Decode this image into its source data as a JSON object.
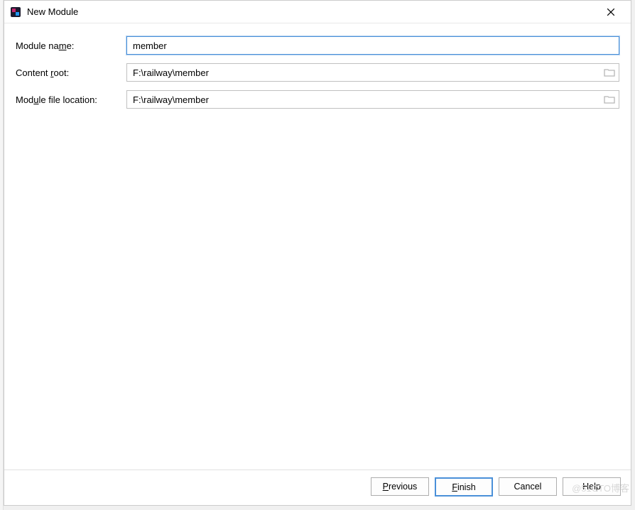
{
  "window": {
    "title": "New Module"
  },
  "form": {
    "module_name": {
      "label_pre": "Module na",
      "label_ul": "m",
      "label_post": "e:",
      "value": "member"
    },
    "content_root": {
      "label_pre": "Content ",
      "label_ul": "r",
      "label_post": "oot:",
      "value": "F:\\railway\\member"
    },
    "module_file_location": {
      "label_pre": "Mod",
      "label_ul": "u",
      "label_post": "le file location:",
      "value": "F:\\railway\\member"
    }
  },
  "buttons": {
    "previous_ul": "P",
    "previous_post": "revious",
    "finish_ul": "F",
    "finish_post": "inish",
    "cancel": "Cancel",
    "help": "Help"
  },
  "watermark": "@51CTO博客"
}
